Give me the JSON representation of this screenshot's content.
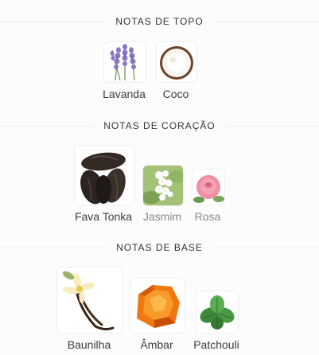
{
  "sections": [
    {
      "title": "NOTAS DE TOPO",
      "notes": [
        {
          "label": "Lavanda",
          "icon": "lavender-icon"
        },
        {
          "label": "Coco",
          "icon": "coconut-icon"
        }
      ]
    },
    {
      "title": "NOTAS DE CORAÇÃO",
      "notes": [
        {
          "label": "Fava Tonka",
          "icon": "tonka-bean-icon"
        },
        {
          "label": "Jasmim",
          "icon": "jasmine-icon"
        },
        {
          "label": "Rosa",
          "icon": "rose-icon"
        }
      ]
    },
    {
      "title": "NOTAS DE BASE",
      "notes": [
        {
          "label": "Baunilha",
          "icon": "vanilla-icon"
        },
        {
          "label": "Âmbar",
          "icon": "amber-icon"
        },
        {
          "label": "Patchouli",
          "icon": "patchouli-icon"
        }
      ]
    }
  ]
}
